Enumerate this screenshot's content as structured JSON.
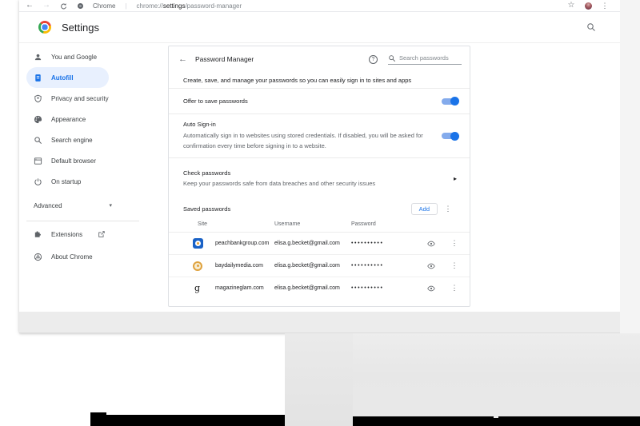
{
  "icons": {
    "back_glyph": "←",
    "forward_glyph": "→",
    "kebab_glyph": "⋮",
    "star_glyph": "☆",
    "caret_down_glyph": "▾",
    "chevron_right_glyph": "▸",
    "pipe": "|",
    "question_glyph": "?"
  },
  "toolbar": {
    "page_label": "Chrome",
    "url_scheme": "chrome://",
    "url_host": "settings",
    "url_path": "/password-manager"
  },
  "settings_header": {
    "title": "Settings"
  },
  "sidebar": {
    "items": [
      {
        "label": "You and Google",
        "icon": "person-icon",
        "selected": false
      },
      {
        "label": "Autofill",
        "icon": "autofill-icon",
        "selected": true
      },
      {
        "label": "Privacy and security",
        "icon": "shield-icon",
        "selected": false
      },
      {
        "label": "Appearance",
        "icon": "palette-icon",
        "selected": false
      },
      {
        "label": "Search engine",
        "icon": "magnifier-icon",
        "selected": false
      },
      {
        "label": "Default browser",
        "icon": "browser-icon",
        "selected": false
      },
      {
        "label": "On startup",
        "icon": "power-icon",
        "selected": false
      }
    ],
    "advanced_label": "Advanced",
    "extensions_label": "Extensions",
    "about_label": "About Chrome"
  },
  "page": {
    "title": "Password Manager",
    "search_placeholder": "Search passwords",
    "intro": "Create, save, and manage your passwords so you can easily sign in to sites and apps",
    "offer_toggle": {
      "label": "Offer to save passwords",
      "state": "on"
    },
    "auto_signin": {
      "label": "Auto Sign-in",
      "description": "Automatically sign in to websites using stored credentials. If disabled, you will be asked for confirmation every time before signing in to a website.",
      "state": "on"
    },
    "check_passwords": {
      "title": "Check passwords",
      "description": "Keep your passwords safe from data breaches and other security issues"
    },
    "saved": {
      "title": "Saved passwords",
      "add_label": "Add",
      "columns": {
        "site": "Site",
        "username": "Username",
        "password": "Password"
      },
      "rows": [
        {
          "site": "peachbankgroup.com",
          "username": "elisa.g.becket@gmail.com",
          "mask": "••••••••••",
          "favicon": "blue-badge"
        },
        {
          "site": "baydailymedia.com",
          "username": "elisa.g.becket@gmail.com",
          "mask": "••••••••••",
          "favicon": "amber-ring"
        },
        {
          "site": "magazineglam.com",
          "username": "elisa.g.becket@gmail.com",
          "mask": "••••••••••",
          "favicon": "letter-g",
          "favicon_text": "g"
        }
      ]
    }
  },
  "colors": {
    "accent_blue": "#1a73e8",
    "selected_item_bg": "#e8f0fe",
    "toggle_track": "#84abec",
    "text_primary": "#202124",
    "text_secondary": "#5f6368",
    "window_footer_gray": "#ececec"
  }
}
